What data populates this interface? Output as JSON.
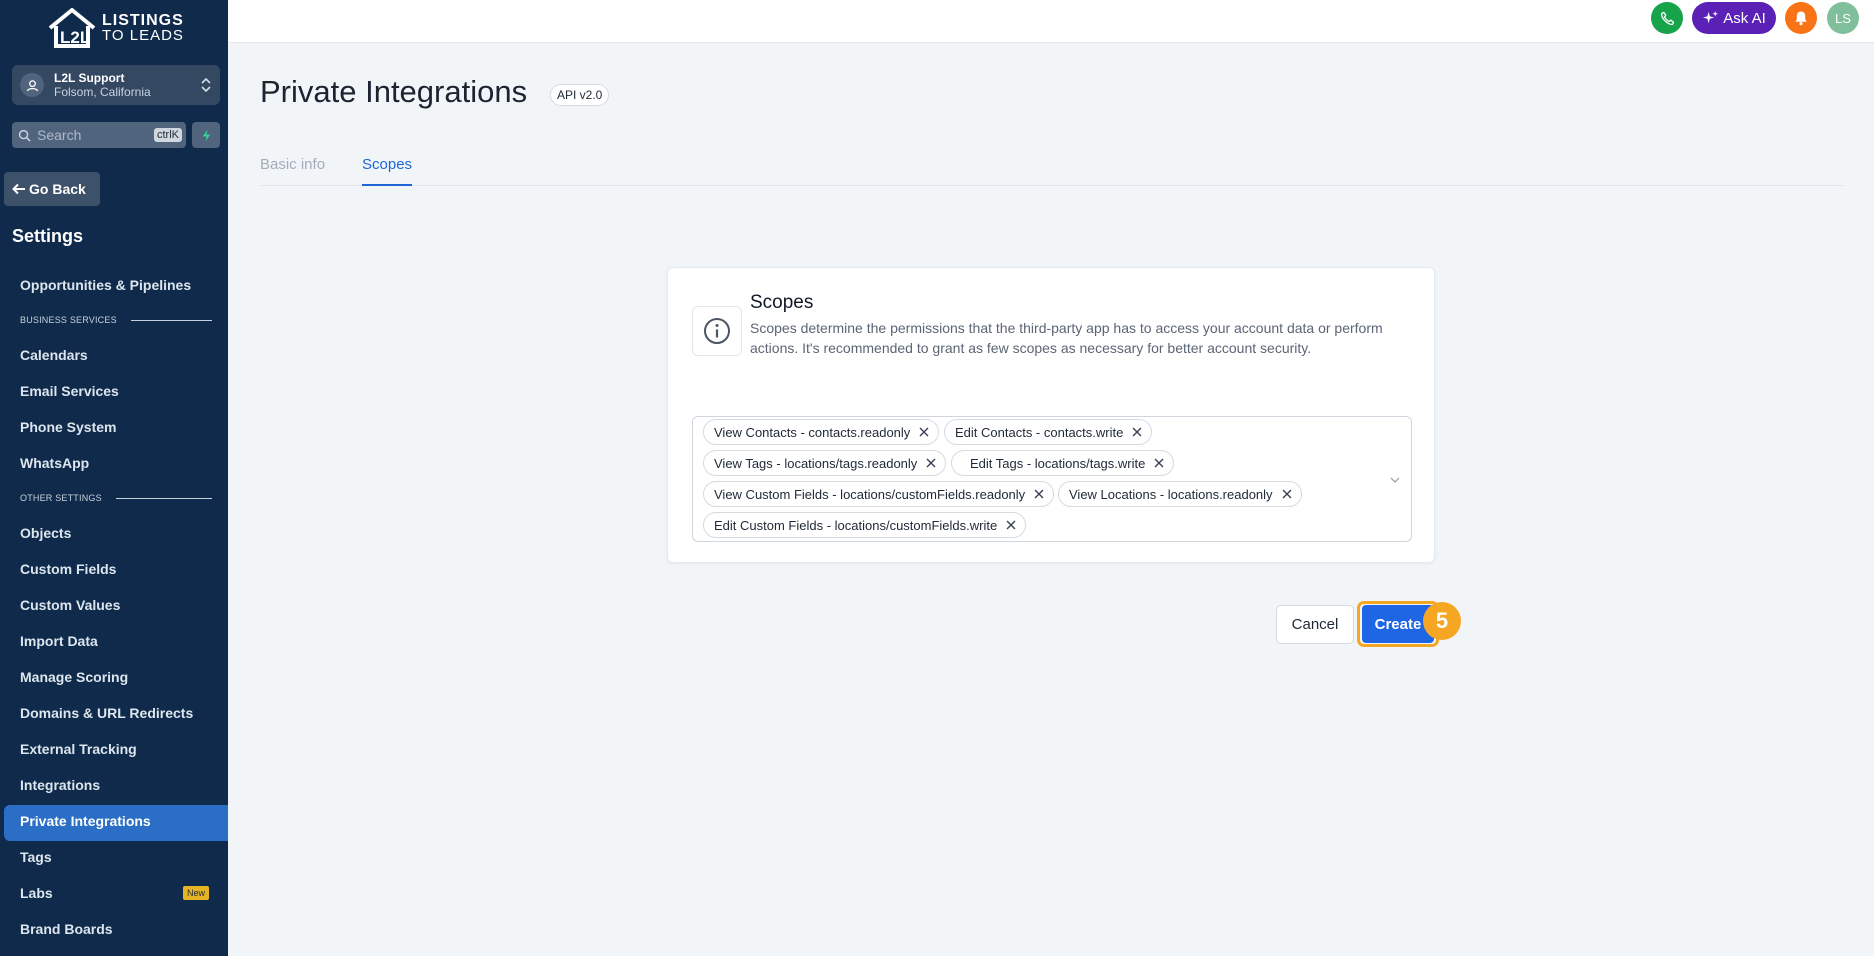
{
  "brand": {
    "line1": "LISTINGS",
    "line2": "TO LEADS",
    "accent": "#0f2a4a"
  },
  "account": {
    "name": "L2L Support",
    "location": "Folsom, California"
  },
  "search": {
    "placeholder": "Search",
    "shortcut": "ctrlK"
  },
  "sidebar": {
    "go_back": "Go Back",
    "heading": "Settings",
    "items": [
      {
        "label": "Opportunities & Pipelines"
      },
      {
        "section": "BUSINESS SERVICES"
      },
      {
        "label": "Calendars"
      },
      {
        "label": "Email Services"
      },
      {
        "label": "Phone System"
      },
      {
        "label": "WhatsApp"
      },
      {
        "section": "OTHER SETTINGS"
      },
      {
        "label": "Objects"
      },
      {
        "label": "Custom Fields"
      },
      {
        "label": "Custom Values"
      },
      {
        "label": "Import Data"
      },
      {
        "label": "Manage Scoring"
      },
      {
        "label": "Domains & URL Redirects"
      },
      {
        "label": "External Tracking"
      },
      {
        "label": "Integrations"
      },
      {
        "label": "Private Integrations",
        "active": true
      },
      {
        "label": "Tags"
      },
      {
        "label": "Labs",
        "badge": "New"
      },
      {
        "label": "Brand Boards"
      }
    ]
  },
  "topbar": {
    "ask_ai": "Ask AI",
    "avatar_initials": "LS"
  },
  "page": {
    "title": "Private Integrations",
    "api_badge": "API v2.0",
    "tabs": [
      {
        "label": "Basic info"
      },
      {
        "label": "Scopes",
        "active": true
      }
    ]
  },
  "scopes_card": {
    "title": "Scopes",
    "description": "Scopes determine the permissions that the third-party app has to access your account data or perform actions. It's recommended to grant as few scopes as necessary for better account security.",
    "selected": [
      "View Contacts - contacts.readonly",
      "Edit Contacts - contacts.write",
      "View Tags - locations/tags.readonly",
      "Edit Tags - locations/tags.write",
      "View Custom Fields - locations/customFields.readonly",
      "View Locations - locations.readonly",
      "Edit Custom Fields - locations/customFields.write"
    ]
  },
  "actions": {
    "cancel": "Cancel",
    "create": "Create",
    "step": "5"
  }
}
